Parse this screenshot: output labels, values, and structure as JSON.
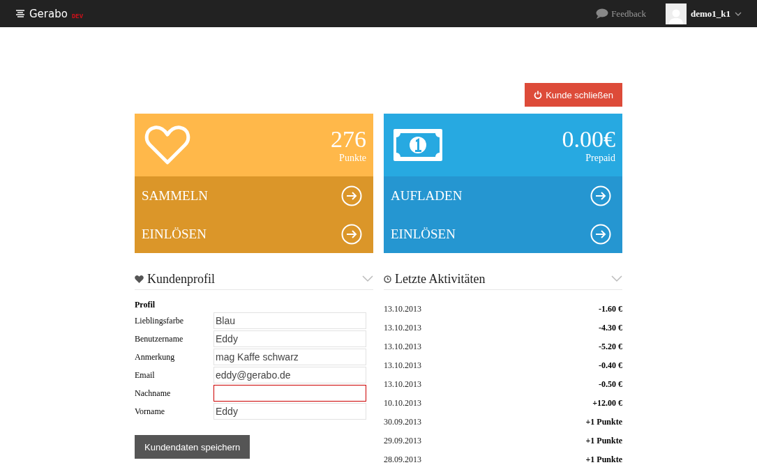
{
  "navbar": {
    "brand": "Gerabo",
    "brand_tag": "DEV",
    "feedback": "Feedback",
    "user": "demo1_k1"
  },
  "close_button": "Kunde schließen",
  "cards": [
    {
      "kind": "points",
      "value": "276",
      "caption": "Punkte",
      "actions": [
        "SAMMELN",
        "EINLÖSEN"
      ]
    },
    {
      "kind": "prepaid",
      "value": "0.00€",
      "caption": "Prepaid",
      "actions": [
        "AUFLADEN",
        "EINLÖSEN"
      ]
    }
  ],
  "profile": {
    "title": "Kundenprofil",
    "section": "Profil",
    "fields": [
      {
        "label": "Lieblingsfarbe",
        "value": "Blau",
        "invalid": false
      },
      {
        "label": "Benutzername",
        "value": "Eddy",
        "invalid": false
      },
      {
        "label": "Anmerkung",
        "value": "mag Kaffe schwarz",
        "invalid": false
      },
      {
        "label": "Email",
        "value": "eddy@gerabo.de",
        "invalid": false
      },
      {
        "label": "Nachname",
        "invalid": true
      },
      {
        "label": "Vorname",
        "value": "Eddy",
        "invalid": false
      }
    ],
    "save_button": "Kundendaten speichern"
  },
  "activities": {
    "title": "Letzte Aktivitäten",
    "rows": [
      {
        "date": "13.10.2013",
        "amount": "-1.60 €"
      },
      {
        "date": "13.10.2013",
        "amount": "-4.30 €"
      },
      {
        "date": "13.10.2013",
        "amount": "-5.20 €"
      },
      {
        "date": "13.10.2013",
        "amount": "-0.40 €"
      },
      {
        "date": "13.10.2013",
        "amount": "-0.50 €"
      },
      {
        "date": "10.10.2013",
        "amount": "+12.00 €"
      },
      {
        "date": "30.09.2013",
        "amount": "+1 Punkte"
      },
      {
        "date": "29.09.2013",
        "amount": "+1 Punkte"
      },
      {
        "date": "28.09.2013",
        "amount": "+1 Punkte"
      }
    ]
  }
}
